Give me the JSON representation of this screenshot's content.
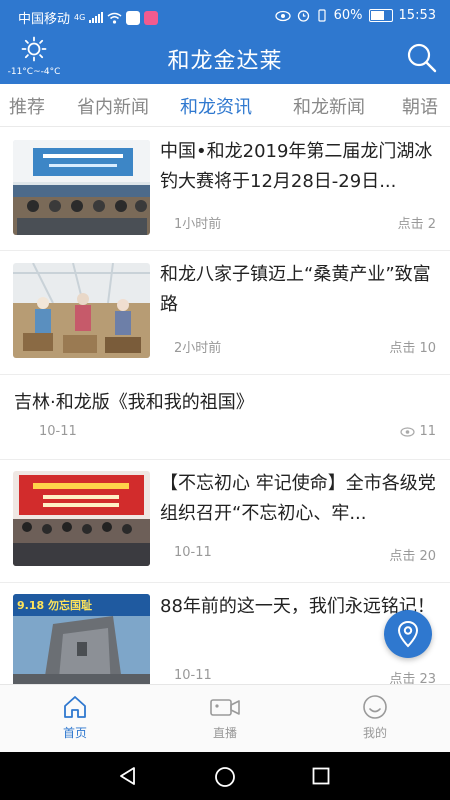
{
  "status_bar": {
    "carrier": "中国移动",
    "network": "4G",
    "battery": "60%",
    "time": "15:53"
  },
  "header": {
    "title": "和龙金达莱",
    "weather": {
      "icon": "sun-icon",
      "temp": "-11°C~-4°C"
    },
    "search_icon": "search-icon"
  },
  "tabs": [
    {
      "label": "推荐",
      "active": false
    },
    {
      "label": "省内新闻",
      "active": false
    },
    {
      "label": "和龙资讯",
      "active": true
    },
    {
      "label": "和龙新闻",
      "active": false
    },
    {
      "label": "朝语",
      "active": false
    }
  ],
  "feed": [
    {
      "title": "中国•和龙2019年第二届龙门湖冰钓大赛将于12月28日-29日...",
      "time": "1小时前",
      "clicks": "点击 2",
      "has_image": true
    },
    {
      "title": "和龙八家子镇迈上“桑黄产业”致富路",
      "time": "2小时前",
      "clicks": "点击 10",
      "has_image": true
    },
    {
      "title": "吉林·和龙版《我和我的祖国》",
      "time": "10-11",
      "views": "11",
      "has_image": false
    },
    {
      "title": "【不忘初心 牢记使命】全市各级党组织召开“不忘初心、牢...",
      "time": "10-11",
      "clicks": "点击 20",
      "has_image": true
    },
    {
      "title": "88年前的这一天，我们永远铭记！",
      "time": "10-11",
      "clicks": "点击 23",
      "has_image": true,
      "thumb_text": "9.18 勿忘国耻"
    }
  ],
  "fab": {
    "icon": "location-pin-icon"
  },
  "bottom_nav": [
    {
      "label": "首页",
      "icon": "home-icon",
      "active": true
    },
    {
      "label": "直播",
      "icon": "video-camera-icon",
      "active": false
    },
    {
      "label": "我的",
      "icon": "smiley-face-icon",
      "active": false
    }
  ],
  "colors": {
    "primary": "#2f78cf",
    "muted": "#999999"
  }
}
